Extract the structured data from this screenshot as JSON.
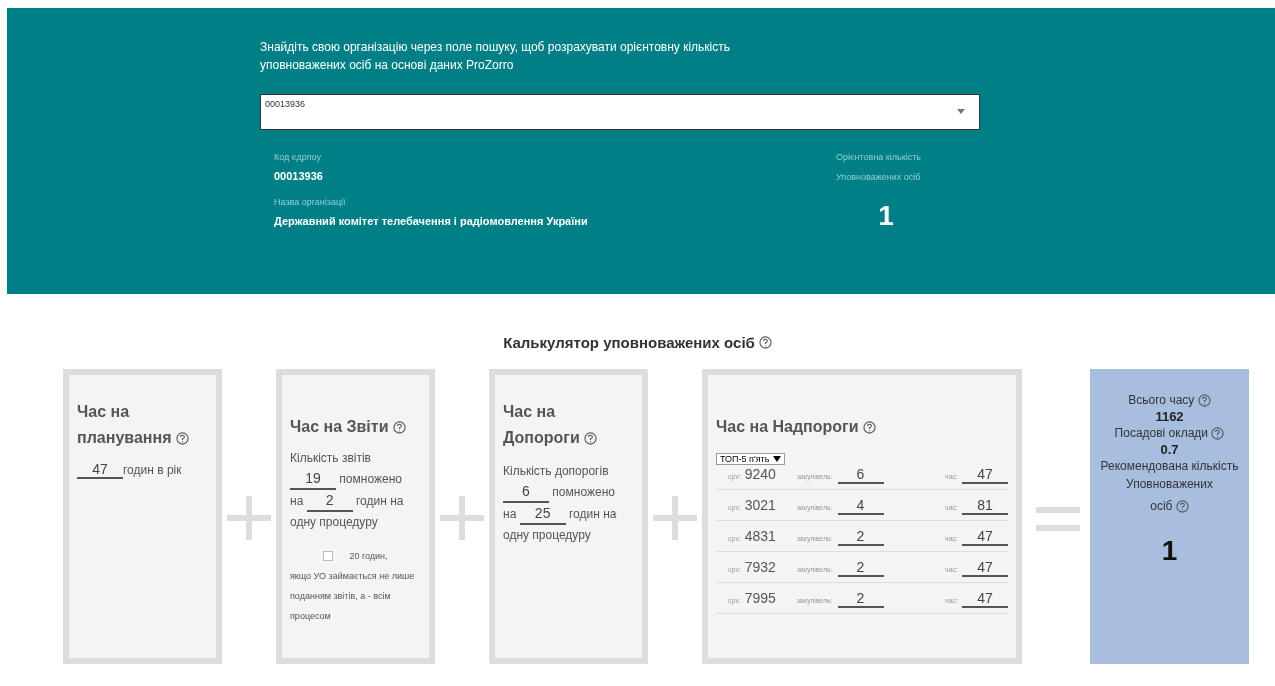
{
  "header": {
    "intro": "Знайдіть свою організацію через поле пошуку, щоб розрахувати орієнтовну кількість уповноважених осіб на основі даних ProZorro",
    "search": {
      "value": "00013936"
    },
    "code_label": "Код єдрпоу",
    "code": "00013936",
    "name_label": "Назва організації",
    "name": "Державний комітет телебачення і радіомовлення України",
    "estimate_label_1": "Орієнтовна кількість",
    "estimate_label_2": "Уповноважених осіб",
    "estimate": "1"
  },
  "calculator": {
    "title": "Калькулятор уповноважених осіб",
    "planning": {
      "title": "Час на планування",
      "hours": "47",
      "unit": "годин в рік"
    },
    "reports": {
      "title": "Час на Звіти",
      "count_label": "Кількість звітів",
      "count": "19",
      "multiplied": "помножено",
      "on": "на",
      "hours": "2",
      "unit": "годин на",
      "unit_2": "одну процедуру",
      "option_checked": false,
      "option_label": "20 годин,",
      "option_note": "якщо УО займається не лише поданням звітів, а - всім процесом"
    },
    "below_threshold": {
      "title": "Час на Допороги",
      "count_label": "Кількість допорогів",
      "count": "6",
      "multiplied": "помножено",
      "on": "на",
      "hours": "25",
      "unit": "годин на",
      "unit_2": "одну процедуру"
    },
    "above_threshold": {
      "title": "Час на Надпороги",
      "select": "ТОП-5 п'ять",
      "rows": [
        {
          "cpv_label": "срv:",
          "cpv": "9240",
          "count_label": "закупівель:",
          "count": "6",
          "hours_label": "час:",
          "hours": "47"
        },
        {
          "cpv_label": "срv:",
          "cpv": "3021",
          "count_label": "закупівель:",
          "count": "4",
          "hours_label": "час:",
          "hours": "81"
        },
        {
          "cpv_label": "срv:",
          "cpv": "4831",
          "count_label": "закупівель:",
          "count": "2",
          "hours_label": "час:",
          "hours": "47"
        },
        {
          "cpv_label": "срv:",
          "cpv": "7932",
          "count_label": "закупівель:",
          "count": "2",
          "hours_label": "час:",
          "hours": "47"
        },
        {
          "cpv_label": "срv:",
          "cpv": "7995",
          "count_label": "закупівель:",
          "count": "2",
          "hours_label": "час:",
          "hours": "47"
        }
      ]
    },
    "result": {
      "total_label": "Всього часу",
      "total": "1162",
      "salary_label": "Посадові оклади",
      "salary": "0.7",
      "recommended_label": "Рекомендована кількість Уповноважених",
      "recommended_label_2": "осіб",
      "recommended": "1"
    }
  }
}
